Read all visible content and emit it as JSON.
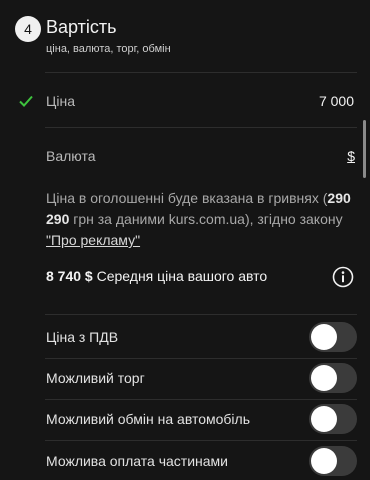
{
  "step": {
    "number": "4",
    "title": "Вартість",
    "subtitle": "ціна, валюта, торг, обмін"
  },
  "price": {
    "label": "Ціна",
    "value": "7 000",
    "checked": true
  },
  "currency": {
    "label": "Валюта",
    "value": "$"
  },
  "note": {
    "text_before": "Ціна в оголошенні буде вказана в гривнях (",
    "amount_bold": "290 290",
    "text_mid": " грн за даними kurs.com.ua), згідно закону ",
    "link_text": "\"Про рекламу\""
  },
  "average": {
    "value": "8 740 $",
    "label": " Середня ціна вашого авто"
  },
  "toggles": [
    {
      "label": "Ціна з ПДВ",
      "on": false
    },
    {
      "label": "Можливий торг",
      "on": false
    },
    {
      "label": "Можливий обмін на автомобіль",
      "on": false
    },
    {
      "label": "Можлива оплата частинами",
      "on": false
    }
  ],
  "colors": {
    "background": "#151515",
    "accent_check": "#3ec33e",
    "toggle_track": "#3b3b3b"
  },
  "icons": [
    "check-icon",
    "info-icon"
  ]
}
